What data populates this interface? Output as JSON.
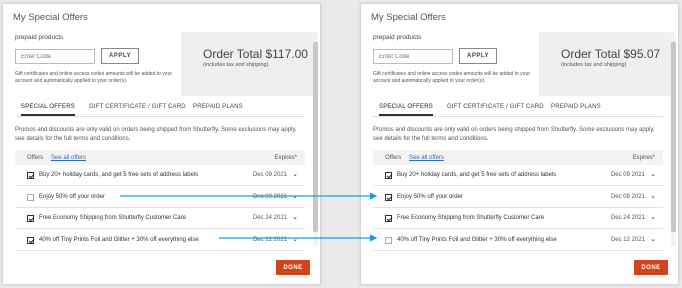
{
  "colors": {
    "accent": "#d1421d",
    "link": "#2a6dbf",
    "arrow": "#1a9be0"
  },
  "left": {
    "dialog_title": "My Special Offers",
    "prepaid_label": "prepaid products",
    "code_placeholder": "Enter Code",
    "apply_label": "APPLY",
    "gift_note": "Gift certificates and online access codes amounts will be added to your account and automatically applied to your order(s).",
    "order_total": "Order Total $117.00",
    "order_sub": "(includes tax and shipping)",
    "tabs": [
      "SPECIAL OFFERS",
      "GIFT CERTIFICATE / GIFT CARD",
      "PREPAID PLANS"
    ],
    "promo_text": "Promos and discounts are only valid on orders being shipped from Shutterfly. Some exclusions may apply, see details for the full terms and conditions.",
    "offers_label": "Offers",
    "see_all": "See all offers",
    "expires_label": "Expires*",
    "offers": [
      {
        "text": "Buy 20+ holiday cards, and get 5 free sets of address labels",
        "date": "Dec 09 2021",
        "checked": true
      },
      {
        "text": "Enjoy 50% off your order",
        "date": "Dec 09 2021",
        "checked": false
      },
      {
        "text": "Free Economy Shipping from Shutterfly Customer Care",
        "date": "Dec 24 2021",
        "checked": true
      },
      {
        "text": "40% off Tiny Prints Foil and Glitter + 30% off everything else",
        "date": "Dec 12 2021",
        "checked": true
      }
    ],
    "done_label": "DONE"
  },
  "right": {
    "dialog_title": "My Special Offers",
    "prepaid_label": "prepaid products",
    "code_placeholder": "Enter Code",
    "apply_label": "APPLY",
    "gift_note": "Gift certificates and online access codes amounts will be added to your account and automatically applied to your order(s).",
    "order_total": "Order Total $95.07",
    "order_sub": "(includes tax and shipping)",
    "tabs": [
      "SPECIAL OFFERS",
      "GIFT CERTIFICATE / GIFT CARD",
      "PREPAID PLANS"
    ],
    "promo_text": "Promos and discounts are only valid on orders being shipped from Shutterfly. Some exclusions may apply, see details for the full terms and conditions.",
    "offers_label": "Offers",
    "see_all": "See all offers",
    "expires_label": "Expires*",
    "offers": [
      {
        "text": "Buy 20+ holiday cards, and get 5 free sets of address labels",
        "date": "Dec 09 2021",
        "checked": true
      },
      {
        "text": "Enjoy 50% off your order",
        "date": "Dec 09 2021",
        "checked": true
      },
      {
        "text": "Free Economy Shipping from Shutterfly Customer Care",
        "date": "Dec 24 2021",
        "checked": true
      },
      {
        "text": "40% off Tiny Prints Foil and Glitter + 30% off everything else",
        "date": "Dec 12 2021",
        "checked": false
      }
    ],
    "done_label": "DONE"
  }
}
